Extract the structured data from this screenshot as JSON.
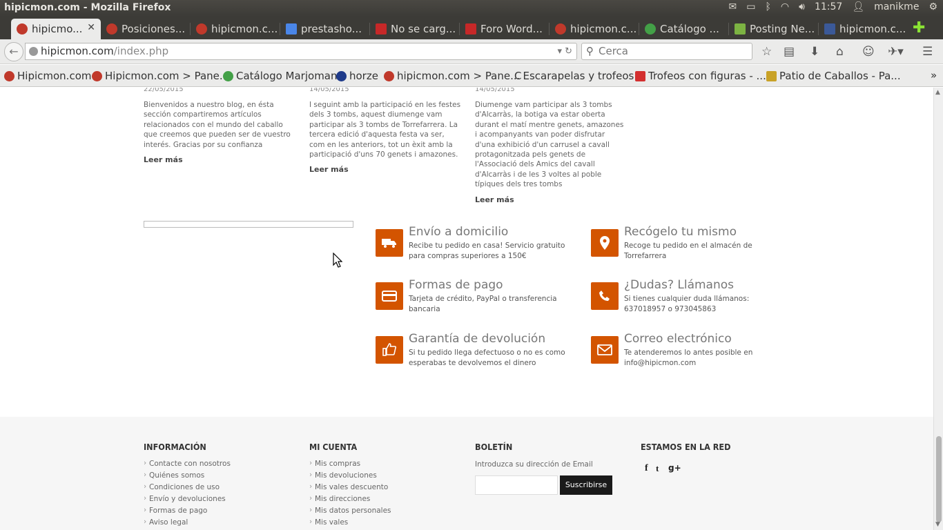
{
  "os": {
    "window_title": "hipicmon.com - Mozilla Firefox",
    "clock": "11:57",
    "user": "manikme"
  },
  "tabs": [
    {
      "label": "hipicmo...",
      "active": true,
      "color": "#c0392b"
    },
    {
      "label": "Posiciones...",
      "color": "#c0392b"
    },
    {
      "label": "hipicmon.c...",
      "color": "#c0392b"
    },
    {
      "label": "prestasho...",
      "color": "#4a86e8"
    },
    {
      "label": "No se carg...",
      "color": "#c62828"
    },
    {
      "label": "Foro Word...",
      "color": "#c62828"
    },
    {
      "label": "hipicmon.c...",
      "color": "#c0392b"
    },
    {
      "label": "Catálogo ...",
      "color": "#43a047"
    },
    {
      "label": "Posting Ne...",
      "color": "#7cb342"
    },
    {
      "label": "hipicmon.c...",
      "color": "#3b5998"
    }
  ],
  "nav": {
    "url_host": "hipicmon.com",
    "url_path": "/index.php",
    "search_placeholder": "Cerca"
  },
  "bookmarks": [
    {
      "label": "Hipicmon.com",
      "color": "#c0392b"
    },
    {
      "label": "Hipicmon.com > Pane...",
      "color": "#c0392b"
    },
    {
      "label": "Catálogo Marjoman",
      "color": "#43a047"
    },
    {
      "label": "horze",
      "color": "#1e3a8a"
    },
    {
      "label": "hipicmon.com > Pane...",
      "color": "#c0392b"
    },
    {
      "label": "Escarapelas y trofeos",
      "color": "#555555"
    },
    {
      "label": "Trofeos con figuras - ...",
      "color": "#d32f2f"
    },
    {
      "label": "Patio de Caballos - Pa...",
      "color": "#c9a227"
    }
  ],
  "posts": [
    {
      "date": "22/05/2015",
      "excerpt": "Bienvenidos a nuestro blog, en ésta sección compartiremos artículos relacionados con el mundo del caballo que creemos que pueden ser de vuestro interés. Gracias por su confianza",
      "more": "Leer más"
    },
    {
      "date": "14/05/2015",
      "excerpt": "I seguint amb la participació en les festes dels 3 tombs, aquest diumenge vam participar als 3 tombs de Torrefarrera. La tercera edició d'aquesta festa va ser, com en les anteriors, tot un èxit amb la participació d'uns 70 genets i amazones.",
      "more": "Leer más"
    },
    {
      "date": "14/05/2015",
      "excerpt": "Diumenge vam participar als 3 tombs d'Alcarràs, la botiga va estar oberta durant el matí mentre genets, amazones i acompanyants van poder disfrutar d'una exhibició d'un carrusel a cavall protagonitzada pels genets de l'Associació dels Amics del cavall d'Alcarràs i de les 3 voltes al poble típiques dels tres tombs",
      "more": "Leer más"
    }
  ],
  "features": [
    {
      "icon": "truck-icon",
      "title": "Envío a domicilio",
      "desc": "Recibe tu pedido en casa! Servicio gratuito para compras superiores a 150€"
    },
    {
      "icon": "map-pin-icon",
      "title": "Recógelo tu mismo",
      "desc": "Recoge tu pedido en el almacén de Torrefarrera"
    },
    {
      "icon": "credit-card-icon",
      "title": "Formas de pago",
      "desc": "Tarjeta de crédito, PayPal  o transferencia bancaria"
    },
    {
      "icon": "phone-icon",
      "title": "¿Dudas? Llámanos",
      "desc": "Si tienes cualquier duda llámanos: 637018957  o  973045863"
    },
    {
      "icon": "thumbs-up-icon",
      "title": "Garantía de devolución",
      "desc": "Si tu pedido llega defectuoso o no es como esperabas te devolvemos el dinero"
    },
    {
      "icon": "envelope-icon",
      "title": "Correo electrónico",
      "desc": "Te atenderemos lo antes posible en info@hipicmon.com"
    }
  ],
  "footer": {
    "info": {
      "title": "INFORMACIÓN",
      "links": [
        "Contacte con nosotros",
        "Quiénes somos",
        "Condiciones de uso",
        "Envío y devoluciones",
        "Formas de pago",
        "Aviso legal"
      ]
    },
    "account": {
      "title": "MI CUENTA",
      "links": [
        "Mis compras",
        "Mis devoluciones",
        "Mis vales descuento",
        "Mis direcciones",
        "Mis datos personales",
        "Mis vales"
      ]
    },
    "newsletter": {
      "title": "BOLETÍN",
      "label": "Introduzca su dirección de Email",
      "button": "Suscribirse"
    },
    "social": {
      "title": "ESTAMOS EN LA RED",
      "items": [
        "f",
        "t",
        "g+"
      ]
    }
  },
  "accent_color": "#d35400"
}
